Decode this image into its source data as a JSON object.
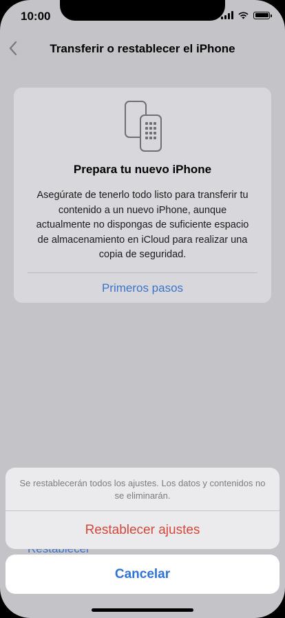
{
  "status_bar": {
    "time": "10:00"
  },
  "nav": {
    "back_icon": "chevron-left-icon",
    "title": "Transferir o restablecer el iPhone"
  },
  "card": {
    "icon": "two-phones-transfer-icon",
    "title": "Prepara tu nuevo iPhone",
    "body": "Asegúrate de tenerlo todo listo para transferir tu contenido a un nuevo iPhone, aunque actualmente no dispongas de suficiente espacio de almacenamiento en iCloud para realizar una copia de seguridad.",
    "link": "Primeros pasos"
  },
  "behind": {
    "partial_text": "Restablecer"
  },
  "action_sheet": {
    "message": "Se restablecerán todos los ajustes. Los datos y contenidos no se eliminarán.",
    "action_label": "Restablecer ajustes",
    "cancel_label": "Cancelar"
  },
  "colors": {
    "background_dimmed": "#c4c4c8",
    "link_blue": "#3a73c8",
    "destructive_red": "#d4473a",
    "cancel_blue": "#2f72d8"
  }
}
